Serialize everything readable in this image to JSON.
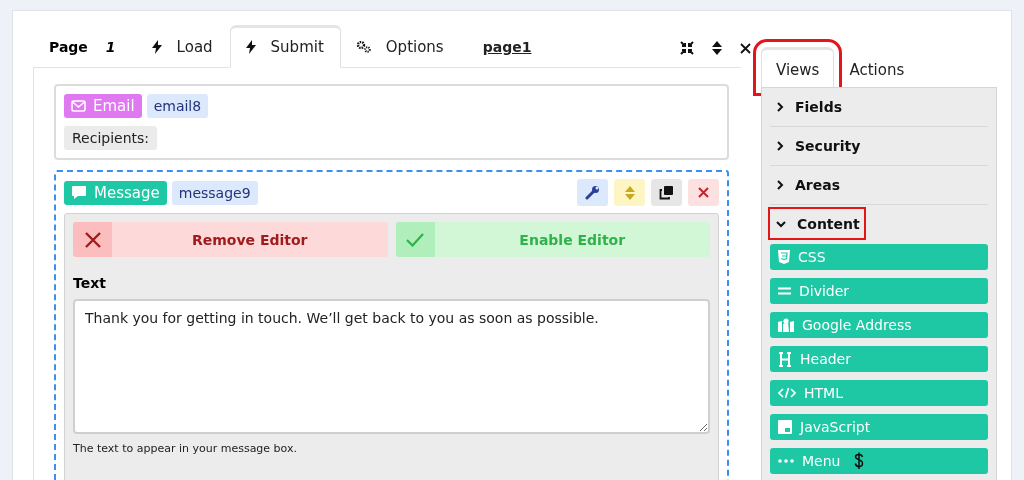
{
  "page_label": "Page",
  "page_number": "1",
  "tabs": [
    {
      "label": "Load",
      "kind": "bolt",
      "selected": false
    },
    {
      "label": "Submit",
      "kind": "bolt",
      "selected": true
    },
    {
      "label": "Options",
      "kind": "gears",
      "selected": false
    }
  ],
  "page_link": "page1",
  "email_block": {
    "badge": "Email",
    "name": "email8",
    "recipients_label": "Recipients:"
  },
  "message_block": {
    "badge": "Message",
    "name": "message9",
    "remove_button": "Remove Editor",
    "enable_button": "Enable Editor",
    "text_label": "Text",
    "text_value": "Thank you for getting in touch. We’ll get back to you as soon as possible.",
    "help": "The text to appear in your message box."
  },
  "side_tabs": [
    {
      "label": "Views",
      "selected": true,
      "highlighted": true
    },
    {
      "label": "Actions",
      "selected": false,
      "highlighted": false
    }
  ],
  "sections": [
    {
      "label": "Fields",
      "expanded": false,
      "highlighted": false
    },
    {
      "label": "Security",
      "expanded": false,
      "highlighted": false
    },
    {
      "label": "Areas",
      "expanded": false,
      "highlighted": false
    },
    {
      "label": "Content",
      "expanded": true,
      "highlighted": true,
      "children": [
        {
          "label": "CSS",
          "kind": "css",
          "premium": false
        },
        {
          "label": "Divider",
          "kind": "divider",
          "premium": false
        },
        {
          "label": "Google Address",
          "kind": "map",
          "premium": false
        },
        {
          "label": "Header",
          "kind": "header",
          "premium": false
        },
        {
          "label": "HTML",
          "kind": "code",
          "premium": false
        },
        {
          "label": "JavaScript",
          "kind": "js",
          "premium": false
        },
        {
          "label": "Menu",
          "kind": "dots",
          "premium": true
        }
      ]
    }
  ]
}
